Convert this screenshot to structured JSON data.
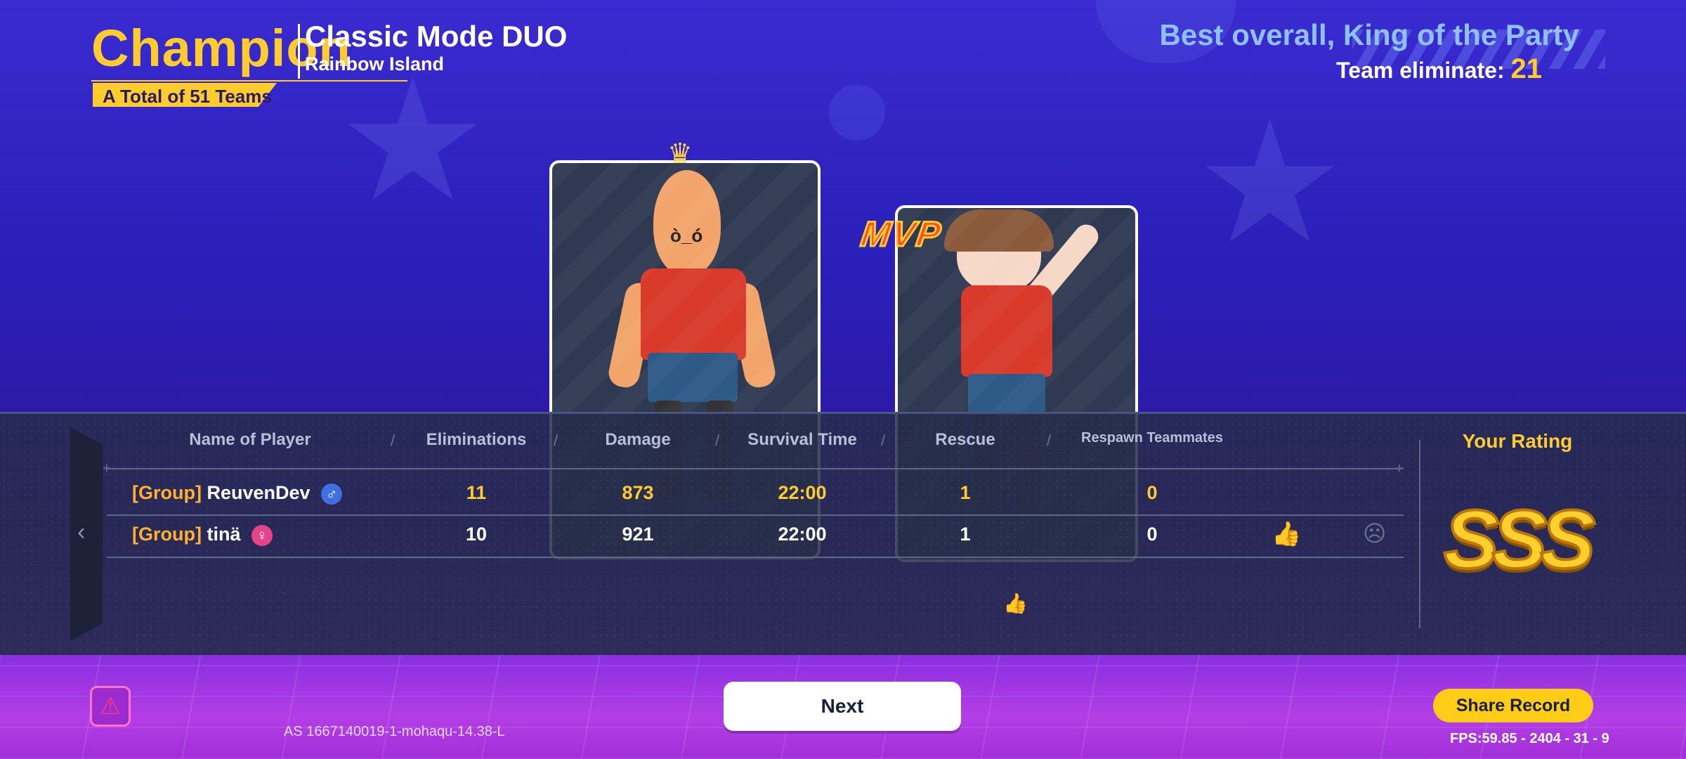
{
  "header": {
    "result": "Champion",
    "mode": "Classic Mode DUO",
    "map": "Rainbow Island",
    "teams_total": "A Total of 51 Teams",
    "award": "Best overall, King of the Party",
    "team_eliminate_label": "Team eliminate:",
    "team_eliminate_value": "21"
  },
  "mvp_badge": "MVP",
  "table": {
    "columns": [
      "Name of Player",
      "Eliminations",
      "Damage",
      "Survival Time",
      "Rescue",
      "Respawn Teammates"
    ],
    "rows": [
      {
        "group": "[Group]",
        "name": "ReuvenDev",
        "gender": "♂",
        "eliminations": "11",
        "damage": "873",
        "survival": "22:00",
        "rescue": "1",
        "respawn": "0"
      },
      {
        "group": "[Group]",
        "name": "tinä",
        "gender": "♀",
        "eliminations": "10",
        "damage": "921",
        "survival": "22:00",
        "rescue": "1",
        "respawn": "0"
      }
    ]
  },
  "rating": {
    "label": "Your Rating",
    "grade": "SSS"
  },
  "footer": {
    "build_info": "AS  1667140019-1-mohaqu-14.38-L",
    "next_label": "Next",
    "share_label": "Share Record",
    "fps": "FPS:59.85 - 2404 - 31 - 9"
  },
  "icons": {
    "warning": "warning-icon",
    "like": "thumbs-up-icon",
    "report": "report-icon",
    "back": "chevron-left-icon"
  },
  "colors": {
    "accent_yellow": "#ffcc2e",
    "award_blue": "#8fc0ff",
    "male": "#3f6fe0",
    "female": "#e6448a"
  }
}
